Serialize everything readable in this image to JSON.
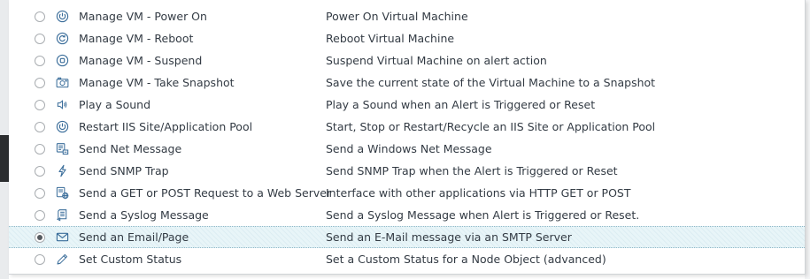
{
  "colors": {
    "text": "#333b44",
    "icon": "#3a6d9a",
    "selected_row_bg": "#e8f5f8",
    "radio_border": "#a9adb1"
  },
  "alert_actions": [
    {
      "name": "Manage VM - Power On",
      "description": "Power On Virtual Machine",
      "icon": "power-icon",
      "selected": false
    },
    {
      "name": "Manage VM - Reboot",
      "description": "Reboot Virtual Machine",
      "icon": "reboot-icon",
      "selected": false
    },
    {
      "name": "Manage VM - Suspend",
      "description": "Suspend Virtual Machine on alert action",
      "icon": "suspend-icon",
      "selected": false
    },
    {
      "name": "Manage VM - Take Snapshot",
      "description": "Save the current state of the Virtual Machine to a Snapshot",
      "icon": "camera-icon",
      "selected": false
    },
    {
      "name": "Play a Sound",
      "description": "Play a Sound when an Alert is Triggered or Reset",
      "icon": "speaker-icon",
      "selected": false
    },
    {
      "name": "Restart IIS Site/Application Pool",
      "description": "Start, Stop or Restart/Recycle an IIS Site or Application Pool",
      "icon": "power-icon",
      "selected": false
    },
    {
      "name": "Send Net Message",
      "description": "Send a Windows Net Message",
      "icon": "net-message-icon",
      "selected": false
    },
    {
      "name": "Send SNMP Trap",
      "description": "Send SNMP Trap when the Alert is Triggered or Reset",
      "icon": "lightning-icon",
      "selected": false
    },
    {
      "name": "Send a GET or POST Request to a Web Server",
      "description": "Interface with other applications via HTTP GET or POST",
      "icon": "web-request-icon",
      "selected": false
    },
    {
      "name": "Send a Syslog Message",
      "description": "Send a Syslog Message when Alert is Triggered or Reset.",
      "icon": "syslog-icon",
      "selected": false
    },
    {
      "name": "Send an Email/Page",
      "description": "Send an E-Mail message via an SMTP Server",
      "icon": "envelope-icon",
      "selected": true
    },
    {
      "name": "Set Custom Status",
      "description": "Set a Custom Status for a Node Object (advanced)",
      "icon": "pencil-icon",
      "selected": false
    }
  ]
}
